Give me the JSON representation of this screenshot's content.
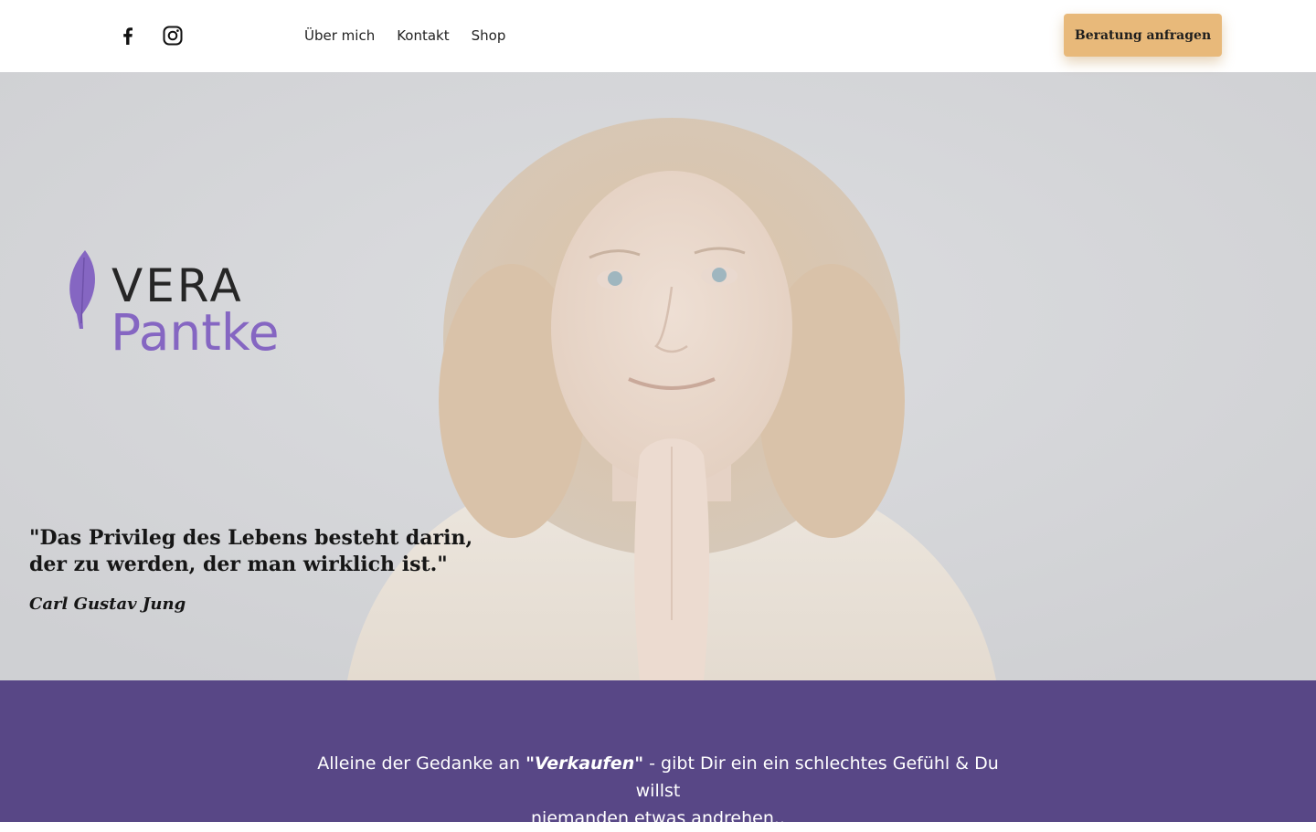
{
  "header": {
    "social": [
      {
        "icon": "facebook-icon",
        "label": "Facebook"
      },
      {
        "icon": "instagram-icon",
        "label": "Instagram"
      }
    ],
    "nav": [
      "Über mich",
      "Kontakt",
      "Shop"
    ],
    "cta_label": "Beratung anfragen"
  },
  "hero": {
    "logo": {
      "line1": "VERA",
      "line2": "Pantke"
    },
    "quote_line1": "\"Das Privileg des Lebens besteht darin,",
    "quote_line2": "der zu werden, der man wirklich ist.\"",
    "author": "Carl Gustav Jung"
  },
  "intro": {
    "before": "Alleine der Gedanke an ",
    "emphasis": "\"Verkaufen\"",
    "after_line1": " - gibt Dir ein ein schlechtes Gefühl & Du willst",
    "line2": "niemanden etwas andrehen.."
  },
  "colors": {
    "accent_button": "#e8b97a",
    "brand_purple": "#8566c2",
    "section_purple": "#584786",
    "hero_background": "#d3d4d6"
  }
}
